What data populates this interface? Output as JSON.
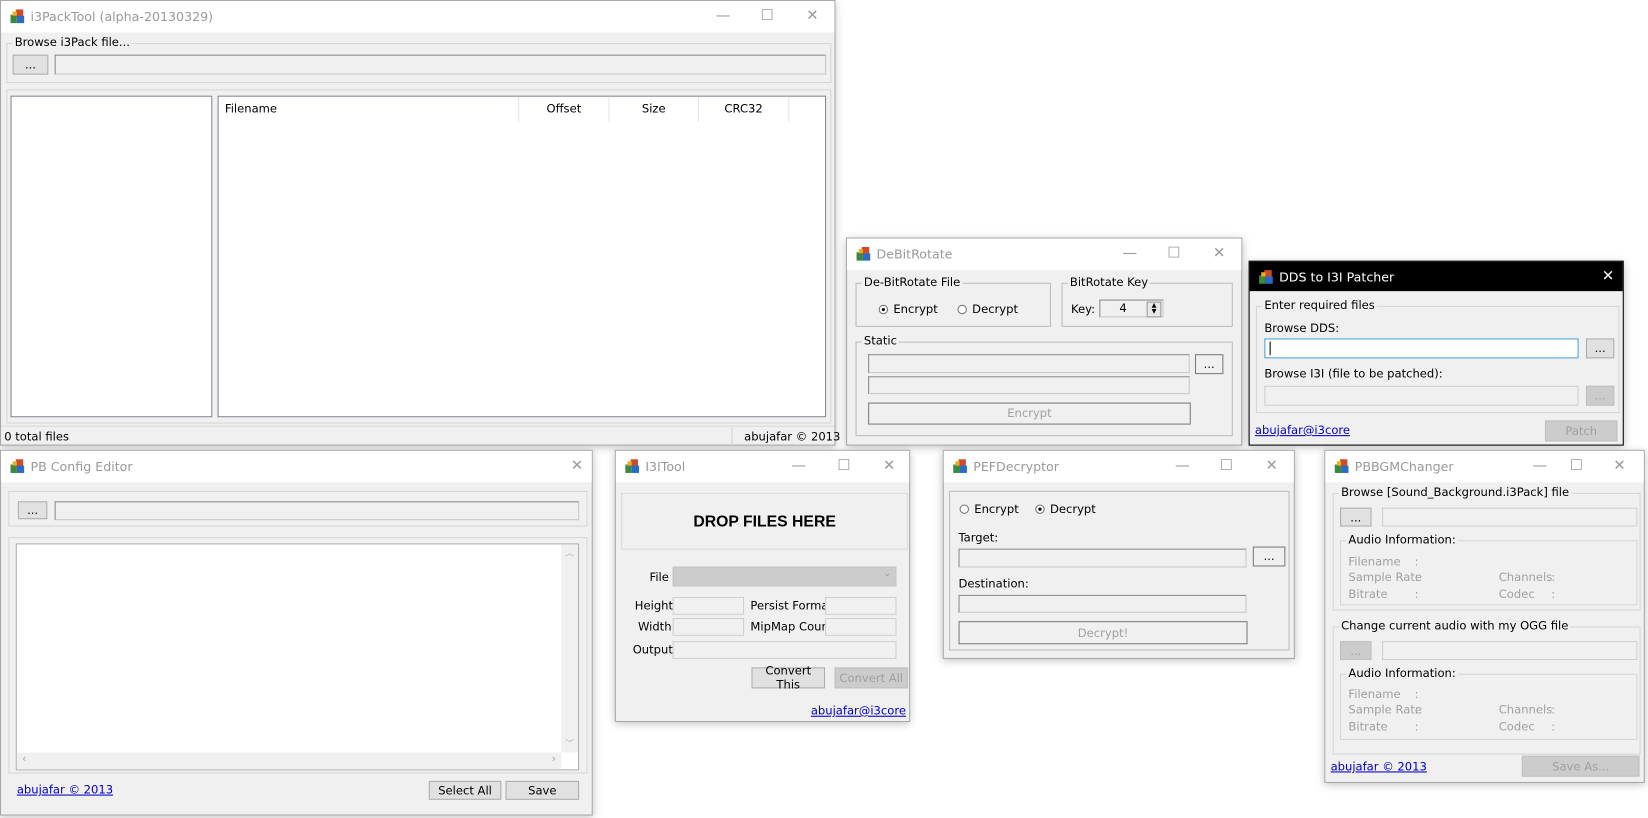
{
  "colors": {
    "window_bg": "#f0f0f0",
    "link": "#0000cc",
    "focus_border": "#4a9fd8",
    "active_titlebar": "#000000"
  },
  "icons": {
    "app": "app-blocks-icon",
    "minimize": "minimize-icon",
    "maximize": "maximize-icon",
    "close": "close-icon"
  },
  "i3packtool": {
    "title": "i3PackTool (alpha-20130329)",
    "browse_group": "Browse i3Pack file...",
    "browse_button": "...",
    "path_value": "",
    "columns": [
      "Filename",
      "Offset",
      "Size",
      "CRC32"
    ],
    "status_left": "0 total files",
    "status_right": "abujafar © 2013"
  },
  "pbconfig": {
    "title": "PB Config Editor",
    "browse_button": "...",
    "path_value": "",
    "editor_text": "",
    "link": "abujafar © 2013",
    "select_all": "Select All",
    "save": "Save"
  },
  "debitrotate": {
    "title": "DeBitRotate",
    "file_group": "De-BitRotate File",
    "encrypt": "Encrypt",
    "decrypt": "Decrypt",
    "selected": "Encrypt",
    "key_group": "BitRotate Key",
    "key_label": "Key:",
    "key_value": "4",
    "static_group": "Static",
    "browse_button": "...",
    "action_button": "Encrypt"
  },
  "dds": {
    "title": "DDS to I3I Patcher",
    "group": "Enter required files",
    "dds_label": "Browse DDS:",
    "dds_value": "",
    "i3i_label": "Browse I3I (file to be patched):",
    "browse_button": "...",
    "link": "abujafar@i3core",
    "patch": "Patch"
  },
  "i3itool": {
    "title": "I3ITool",
    "drop": "DROP FILES HERE",
    "file_label": "File",
    "height_label": "Height",
    "width_label": "Width",
    "persist_label": "Persist Format",
    "mipmap_label": "MipMap Count",
    "output_label": "Output",
    "convert_this": "Convert This",
    "convert_all": "Convert All",
    "link": "abujafar@i3core"
  },
  "pef": {
    "title": "PEFDecryptor",
    "encrypt": "Encrypt",
    "decrypt": "Decrypt",
    "selected": "Decrypt",
    "target_label": "Target:",
    "destination_label": "Destination:",
    "browse_button": "...",
    "action_button": "Decrypt!"
  },
  "pbbgm": {
    "title": "PBBGMChanger",
    "group1": "Browse [Sound_Background.i3Pack] file",
    "group2": "Change current audio with my OGG file",
    "browse_button": "...",
    "audio_info": "Audio Information:",
    "filename": "Filename",
    "sample_rate": "Sample Rate",
    "bitrate": "Bitrate",
    "channels": "Channels",
    "codec": "Codec",
    "colon": ":",
    "link": "abujafar © 2013",
    "save_as": "Save As..."
  }
}
